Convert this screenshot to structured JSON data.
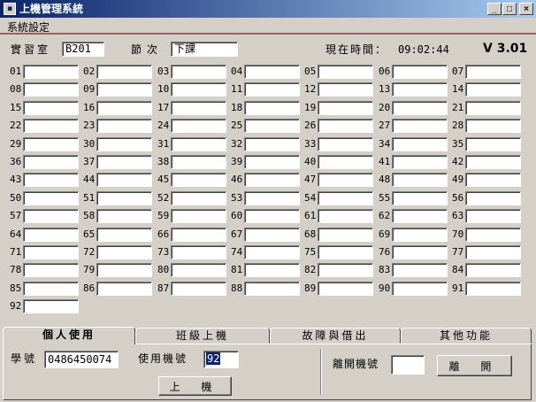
{
  "window": {
    "title": "上機管理系統",
    "icon_glyph": "▪"
  },
  "controls": {
    "minimize": "_",
    "maximize": "□",
    "close": "×"
  },
  "menu": {
    "items": [
      "系統設定"
    ]
  },
  "header": {
    "lab_label": "實習室",
    "lab_value": "B201",
    "period_label": "節次",
    "period_value": "下課",
    "time_label": "現在時間：",
    "time_value": "09:02:44",
    "version": "V 3.01"
  },
  "seats": [
    "01",
    "02",
    "03",
    "04",
    "05",
    "06",
    "07",
    "08",
    "09",
    "10",
    "11",
    "12",
    "13",
    "14",
    "15",
    "16",
    "17",
    "18",
    "19",
    "20",
    "21",
    "22",
    "23",
    "24",
    "25",
    "26",
    "27",
    "28",
    "29",
    "30",
    "31",
    "32",
    "33",
    "34",
    "35",
    "36",
    "37",
    "38",
    "39",
    "40",
    "41",
    "42",
    "43",
    "44",
    "45",
    "46",
    "47",
    "48",
    "49",
    "50",
    "51",
    "52",
    "53",
    "54",
    "55",
    "56",
    "57",
    "58",
    "59",
    "60",
    "61",
    "62",
    "63",
    "64",
    "65",
    "66",
    "67",
    "68",
    "69",
    "70",
    "71",
    "72",
    "73",
    "74",
    "75",
    "76",
    "77",
    "78",
    "79",
    "80",
    "81",
    "82",
    "83",
    "84",
    "85",
    "86",
    "87",
    "88",
    "89",
    "90",
    "91",
    "92"
  ],
  "tabs": [
    "個人使用",
    "班級上機",
    "故障與借出",
    "其他功能"
  ],
  "personal": {
    "student_id_label": "學號",
    "student_id_value": "0486450074",
    "machine_label": "使用機號",
    "machine_value": "92",
    "login_button": "上 機",
    "leave_label": "離開機號",
    "leave_value": "",
    "leave_button": "離 開"
  }
}
